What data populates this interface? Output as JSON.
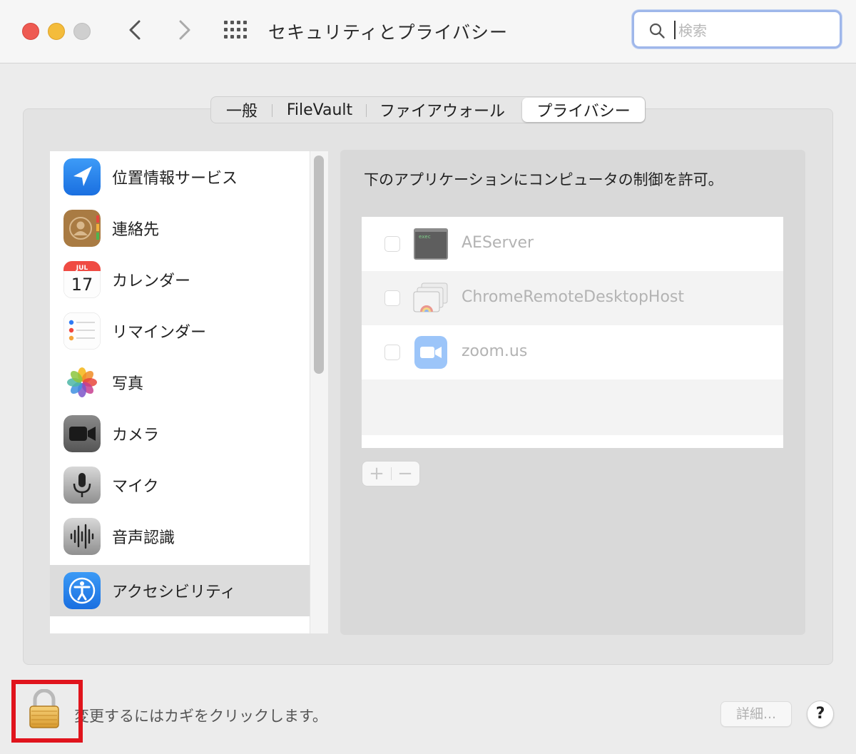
{
  "window": {
    "title": "セキュリティとプライバシー",
    "search_placeholder": "検索"
  },
  "tabs": [
    {
      "label": "一般"
    },
    {
      "label": "FileVault"
    },
    {
      "label": "ファイアウォール"
    },
    {
      "label": "プライバシー",
      "active": true
    }
  ],
  "sidebar": {
    "items": [
      {
        "label": "位置情報サービス",
        "icon": "location-arrow-icon"
      },
      {
        "label": "連絡先",
        "icon": "contacts-icon"
      },
      {
        "label": "カレンダー",
        "icon": "calendar-icon",
        "icon_month": "JUL",
        "icon_day": "17"
      },
      {
        "label": "リマインダー",
        "icon": "reminders-icon"
      },
      {
        "label": "写真",
        "icon": "photos-icon"
      },
      {
        "label": "カメラ",
        "icon": "camera-icon"
      },
      {
        "label": "マイク",
        "icon": "microphone-icon"
      },
      {
        "label": "音声認識",
        "icon": "speech-recognition-icon"
      },
      {
        "label": "アクセシビリティ",
        "icon": "accessibility-icon",
        "selected": true
      }
    ]
  },
  "pane": {
    "caption": "下のアプリケーションにコンピュータの制御を許可。",
    "apps": [
      {
        "name": "AEServer",
        "icon": "exec-terminal-icon",
        "icon_text": "exec",
        "checked": false
      },
      {
        "name": "ChromeRemoteDesktopHost",
        "icon": "chrome-remote-desktop-icon",
        "checked": false
      },
      {
        "name": "zoom.us",
        "icon": "zoom-icon",
        "checked": false
      }
    ],
    "add_label": "+",
    "remove_label": "−"
  },
  "footer": {
    "lock_text": "変更するにはカギをクリックします。",
    "details_label": "詳細...",
    "help_label": "?"
  },
  "colors": {
    "highlight_frame": "#e0141c",
    "search_focus": "#9fb7ea",
    "selected_row": "#dcdcdc"
  }
}
